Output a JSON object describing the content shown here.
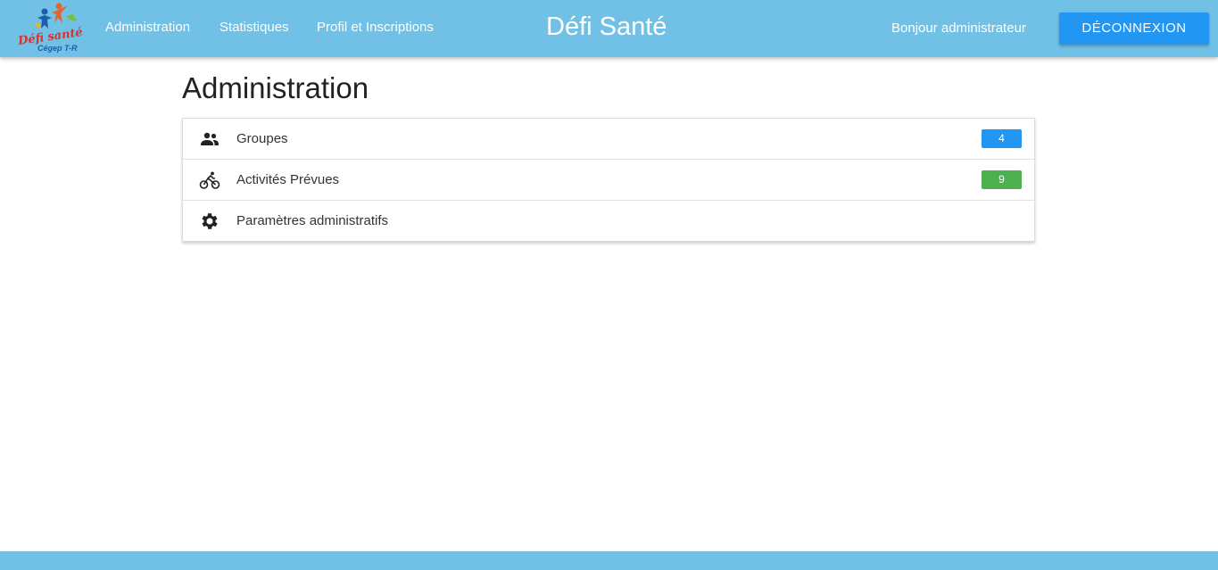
{
  "navbar": {
    "logo": {
      "name": "Défi santé",
      "subtitle": "Cégep T-R"
    },
    "links": [
      "Administration",
      "Statistiques",
      "Profil et Inscriptions"
    ],
    "brand": "Défi Santé",
    "greeting": "Bonjour administrateur",
    "logout_label": "DÉCONNEXION",
    "background": "#71c0e6",
    "button_color": "#2196f3"
  },
  "main": {
    "title": "Administration",
    "items": [
      {
        "label": "Groupes",
        "icon": "people-icon",
        "badge": "4",
        "badge_color": "#2196f3"
      },
      {
        "label": "Activités Prévues",
        "icon": "bike-icon",
        "badge": "9",
        "badge_color": "#4caf50"
      },
      {
        "label": "Paramètres administratifs",
        "icon": "gear-icon"
      }
    ]
  }
}
